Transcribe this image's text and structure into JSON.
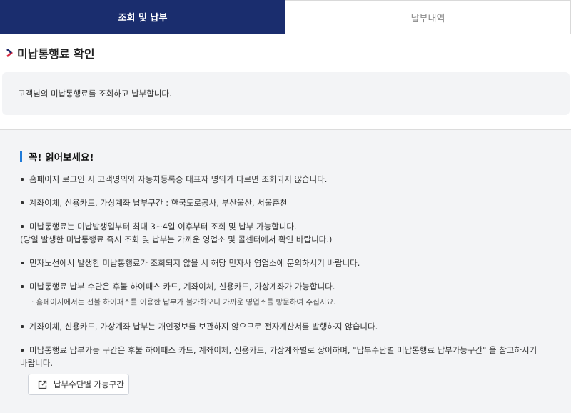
{
  "tabs": [
    {
      "label": "조회 및 납부",
      "active": true
    },
    {
      "label": "납부내역",
      "active": false
    }
  ],
  "section": {
    "title": "미납통행료 확인",
    "intro": "고객님의 미납통행료를 조회하고 납부합니다."
  },
  "notice": {
    "title": "꼭! 읽어보세요!",
    "items": [
      {
        "text": "홈페이지 로그인 시 고객명의와 자동차등록증 대표자 명의가 다르면 조회되지 않습니다."
      },
      {
        "text": "계좌이체, 신용카드, 가상계좌 납부구간 : 한국도로공사, 부산울산, 서울춘천"
      },
      {
        "text": "미납통행료는 미납발생일부터 최대 3~4일 이후부터 조회 및 납부 가능합니다.",
        "text2": "(당일 발생한 미납통행료 즉시 조회 및 납부는 가까운 영업소 및 콜센터에서 확인 바랍니다.)"
      },
      {
        "text": "민자노선에서 발생한 미납통행료가 조회되지 않을 시 해당 민자사 영업소에 문의하시기 바랍니다."
      },
      {
        "text": "미납통행료 납부 수단은 후불 하이패스 카드, 계좌이체, 신용카드, 가상계좌가 가능합니다.",
        "sub": "· 홈페이지에서는 선불 하이패스를 이용한 납부가 불가하오니 가까운 영업소를 방문하여 주십시요."
      },
      {
        "text": "계좌이체, 신용카드, 가상계좌 납부는 개인정보를 보관하지 않으므로 전자계산서를 발행하지 않습니다."
      },
      {
        "text": "미납통행료 납부가능 구간은 후불 하이패스 카드, 계좌이체, 신용카드, 가상계좌별로 상이하며, \"납부수단별 미납통행료 납부가능구간\" 을 참고하시기",
        "text2": "바랍니다."
      }
    ],
    "guide_button": "납부수단별 가능구간"
  },
  "colors": {
    "tab_active_bg": "#1a2d6e",
    "accent_blue": "#1f7ad8",
    "arrow_red": "#d7263d",
    "panel_bg": "#f3f4f6"
  },
  "icons": {
    "title_marker": "chevron-right-icon",
    "guide_button": "external-link-icon"
  }
}
